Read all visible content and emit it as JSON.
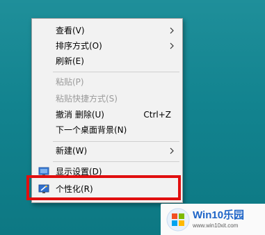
{
  "context_menu": {
    "items": [
      {
        "label": "查看(V)",
        "submenu": true
      },
      {
        "label": "排序方式(O)",
        "submenu": true
      },
      {
        "label": "刷新(E)"
      },
      {
        "label": "粘贴(P)",
        "disabled": true
      },
      {
        "label": "粘贴快捷方式(S)",
        "disabled": true
      },
      {
        "label": "撤消 删除(U)",
        "shortcut": "Ctrl+Z"
      },
      {
        "label": "下一个桌面背景(N)"
      },
      {
        "label": "新建(W)",
        "submenu": true
      },
      {
        "label": "显示设置(D)",
        "icon": "display-settings-icon"
      },
      {
        "label": "个性化(R)",
        "icon": "personalize-icon"
      }
    ]
  },
  "highlight": {
    "target": "个性化(R)",
    "color": "#e10f0f"
  },
  "watermark": {
    "brand": "Win10乐园",
    "url": "www.win10xit.com"
  },
  "colors": {
    "desktop": "#1a8b96",
    "menu_bg": "#f2f2f2",
    "disabled_text": "#9b9b9b"
  }
}
